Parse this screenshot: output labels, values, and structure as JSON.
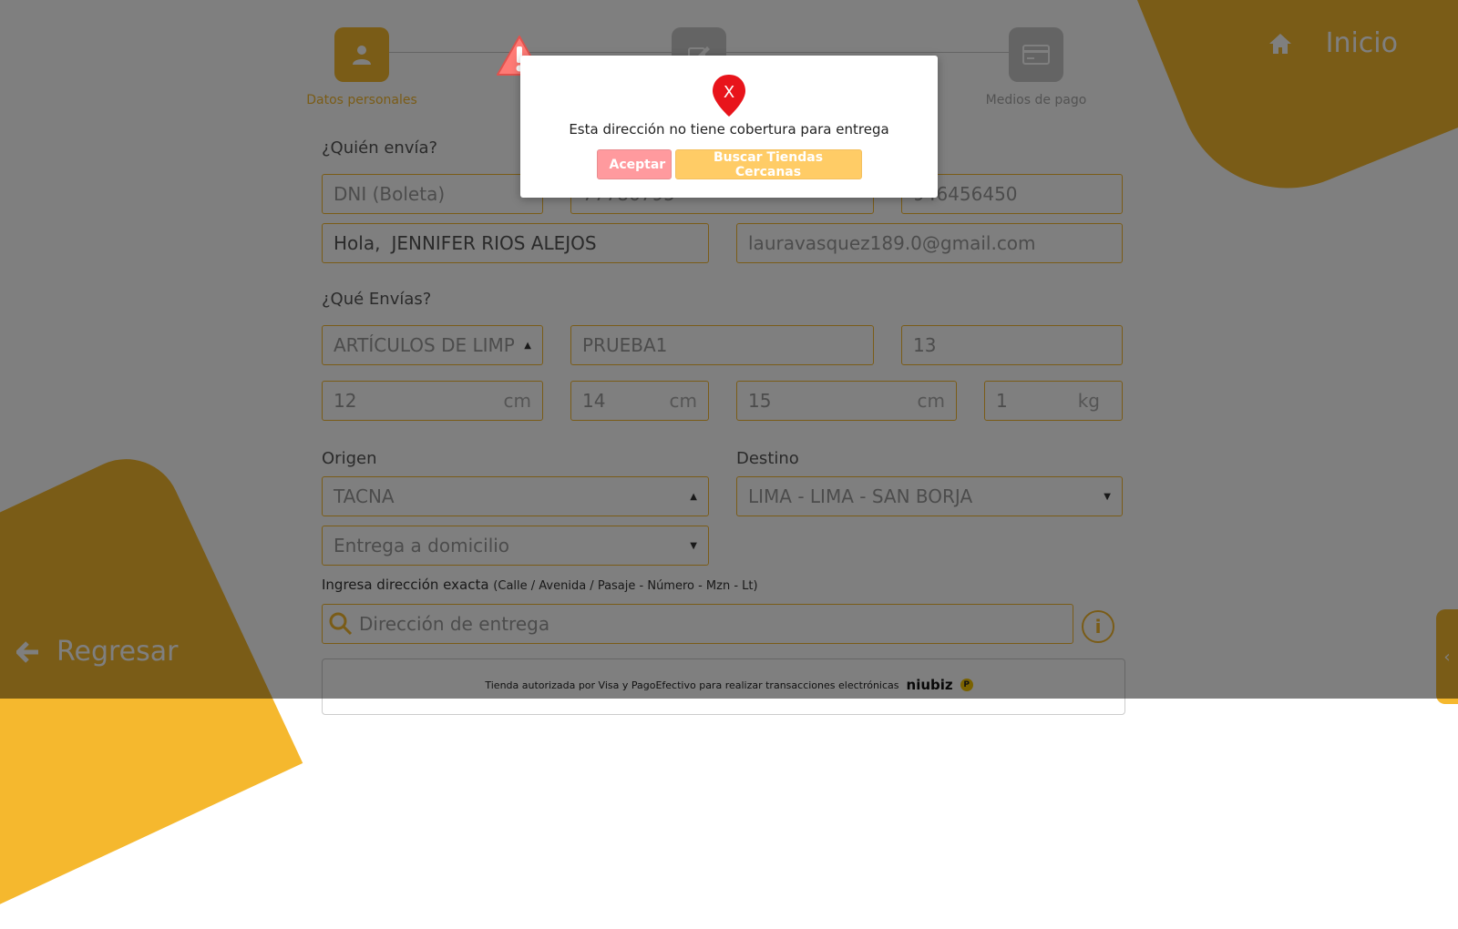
{
  "nav": {
    "inicio": "Inicio",
    "regresar": "Regresar"
  },
  "stepper": {
    "step1": "Datos personales",
    "step4": "Medios de pago"
  },
  "sender": {
    "title": "¿Quién envía?",
    "doc_type": "DNI (Boleta)",
    "doc_number": "77786795",
    "phone": "946456450",
    "greeting": "Hola,",
    "name": "JENNIFER RIOS ALEJOS",
    "email": "lauravasquez189.0@gmail.com"
  },
  "package": {
    "title": "¿Qué Envías?",
    "category": "ARTÍCULOS DE LIMPIEZA",
    "description": "PRUEBA1",
    "quantity": "13",
    "length": "12",
    "width": "14",
    "height": "15",
    "weight": "1",
    "unit_cm": "cm",
    "unit_kg": "kg"
  },
  "route": {
    "origin_label": "Origen",
    "origin_value": "TACNA",
    "destination_label": "Destino",
    "destination_value": "LIMA - LIMA - SAN BORJA",
    "delivery_type": "Entrega a domicilio",
    "address_label": "Ingresa dirección exacta",
    "address_hint": "(Calle / Avenida / Pasaje - Número - Mzn - Lt)",
    "address_placeholder": "Dirección de entrega"
  },
  "footer": {
    "text": "Tienda autorizada por Visa y PagoEfectivo para realizar transacciones electrónicas",
    "brand": "niubiz",
    "pe_badge": "P"
  },
  "modal": {
    "pin_letter": "X",
    "message": "Esta dirección no tiene cobertura para entrega",
    "accept": "Aceptar",
    "search": "Buscar Tiendas Cercanas"
  },
  "colors": {
    "accent": "#f5b82e",
    "error": "#e8141b",
    "accept_btn": "#ff9a9e",
    "search_btn": "#ffcc66"
  }
}
